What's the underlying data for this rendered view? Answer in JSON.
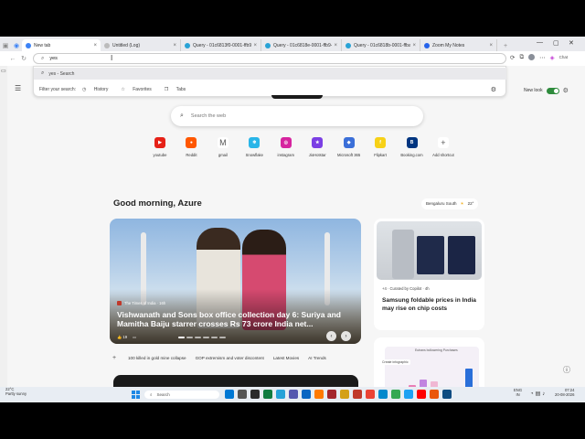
{
  "browser": {
    "tabs": [
      {
        "title": "New tab",
        "active": true,
        "color": "#3b82f6"
      },
      {
        "title": "Untitled (Log)",
        "active": false,
        "color": "#bbbbbb"
      },
      {
        "title": "Query - 01c6813f0-0001-ffb9-0000-",
        "active": false,
        "color": "#29a3d6"
      },
      {
        "title": "Query - 01c6818e-0001-ffb9-0000-",
        "active": false,
        "color": "#29a3d6"
      },
      {
        "title": "Query - 01c6818b-0001-ffba-0000-",
        "active": false,
        "color": "#29a3d6"
      },
      {
        "title": "Zoom My Notes",
        "active": false,
        "color": "#2563eb"
      }
    ],
    "address_value": "yes",
    "suggestion": "yes - Search",
    "filter_label": "Filter your search:",
    "filters": [
      "History",
      "Favorites",
      "Tabs"
    ],
    "profile": "Chat"
  },
  "page": {
    "new_look": "New look",
    "search_placeholder": "Search the web",
    "shortcuts": [
      {
        "label": "youtube",
        "color": "#e62117",
        "glyph": "▶"
      },
      {
        "label": "Reddit",
        "color": "#ff5700",
        "glyph": "●"
      },
      {
        "label": "gmail",
        "color": "#ffffff",
        "glyph": "M"
      },
      {
        "label": "Snowflake",
        "color": "#29b5e8",
        "glyph": "❄"
      },
      {
        "label": "instagram",
        "color": "#d6249f",
        "glyph": "◎"
      },
      {
        "label": "JioHotstar",
        "color": "#7b3fe4",
        "glyph": "★"
      },
      {
        "label": "Microsoft 365",
        "color": "#3b6fd8",
        "glyph": "◆"
      },
      {
        "label": "Flipkart",
        "color": "#f7d117",
        "glyph": "f"
      },
      {
        "label": "Booking.com",
        "color": "#003580",
        "glyph": "B"
      },
      {
        "label": "Add shortcut",
        "color": "#ffffff",
        "glyph": "+"
      }
    ],
    "greeting": "Good morning, Azure",
    "weather_location": "Bengaluru South",
    "weather_temp": "22°",
    "hero": {
      "source": "The Times of India · 16h",
      "headline": "Vishwanath and Sons box office collection day 6: Suriya and Mamitha Baiju starrer crosses Rs 73 crore India net...",
      "likes": "19"
    },
    "card2": {
      "curated": "+4 · Curated by Copilot · 4h",
      "headline": "Samsung foldable prices in India may rise on chip costs"
    },
    "card3": {
      "panel_title": "Eutrans bollowering Purchases",
      "create_label": "Create infographic"
    },
    "chips": [
      "100 killed in gold mine collapse",
      "GOP extremism and voter discontent",
      "Latest Movies",
      "AI Trends"
    ]
  },
  "taskbar": {
    "weather_temp": "22°C",
    "weather_desc": "Partly sunny",
    "search": "Search",
    "lang": "ENG",
    "region": "IN",
    "time": "07:24",
    "date": "20-08-2026",
    "apps": [
      "#0078d4",
      "#555",
      "#2b2b2b",
      "#107c41",
      "#26a2d8",
      "#5558af",
      "#0a66c2",
      "#ff7a00",
      "#a4262c",
      "#d4a017",
      "#c0392b",
      "#ea4335",
      "#0088cc",
      "#34a853",
      "#1da1f2",
      "#ff0000",
      "#ea580c",
      "#0f4c81"
    ]
  }
}
